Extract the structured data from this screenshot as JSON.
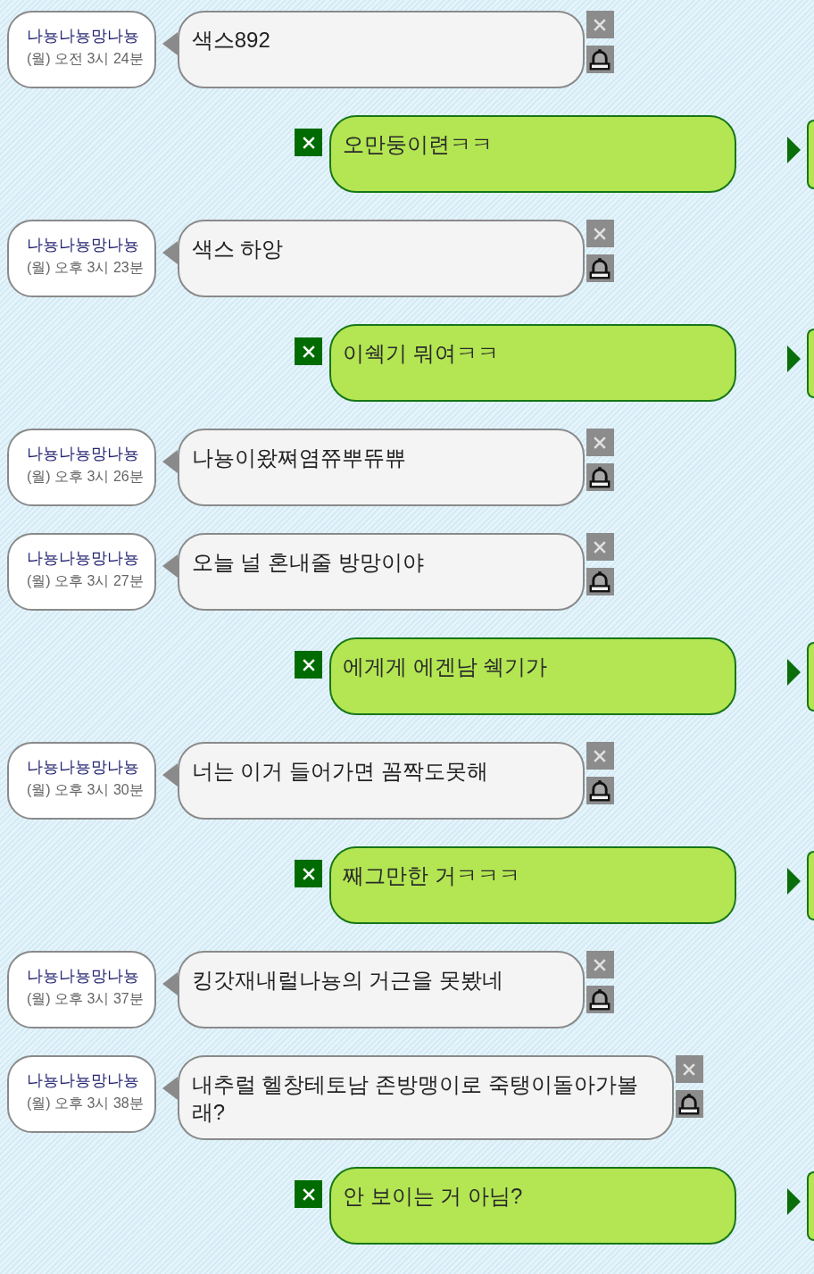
{
  "messages": [
    {
      "kind": "received",
      "sender": "나뇽나뇽망나뇽",
      "time": "(월) 오전 3시 24분",
      "text": "색스892"
    },
    {
      "kind": "sent",
      "text": "오만둥이련ㅋㅋ"
    },
    {
      "kind": "received",
      "sender": "나뇽나뇽망나뇽",
      "time": "(월) 오후 3시 23분",
      "text": "색스 하앙"
    },
    {
      "kind": "sent",
      "text": "이쉑기 뭐여ㅋㅋ"
    },
    {
      "kind": "received",
      "sender": "나뇽나뇽망나뇽",
      "time": "(월) 오후 3시 26분",
      "text": "나뇽이왔쪄염쮸뿌뜌쀼"
    },
    {
      "kind": "received",
      "sender": "나뇽나뇽망나뇽",
      "time": "(월) 오후 3시 27분",
      "text": "오늘 널 혼내줄 방망이야"
    },
    {
      "kind": "sent",
      "text": "에게게 에겐남 쉑기가"
    },
    {
      "kind": "received",
      "sender": "나뇽나뇽망나뇽",
      "time": "(월) 오후 3시 30분",
      "text": "너는 이거 들어가면 꼼짝도못해"
    },
    {
      "kind": "sent",
      "text": "째그만한 거ㅋㅋㅋ"
    },
    {
      "kind": "received",
      "sender": "나뇽나뇽망나뇽",
      "time": "(월) 오후 3시 37분",
      "text": "킹갓재내럴나뇽의 거근을 못봤네"
    },
    {
      "kind": "received",
      "sender": "나뇽나뇽망나뇽",
      "time": "(월) 오후 3시 38분",
      "text": "내추럴 헬창테토남 존방맹이로 죽탱이돌아가볼래?"
    },
    {
      "kind": "sent",
      "text": "안 보이는 거 아님?"
    }
  ]
}
